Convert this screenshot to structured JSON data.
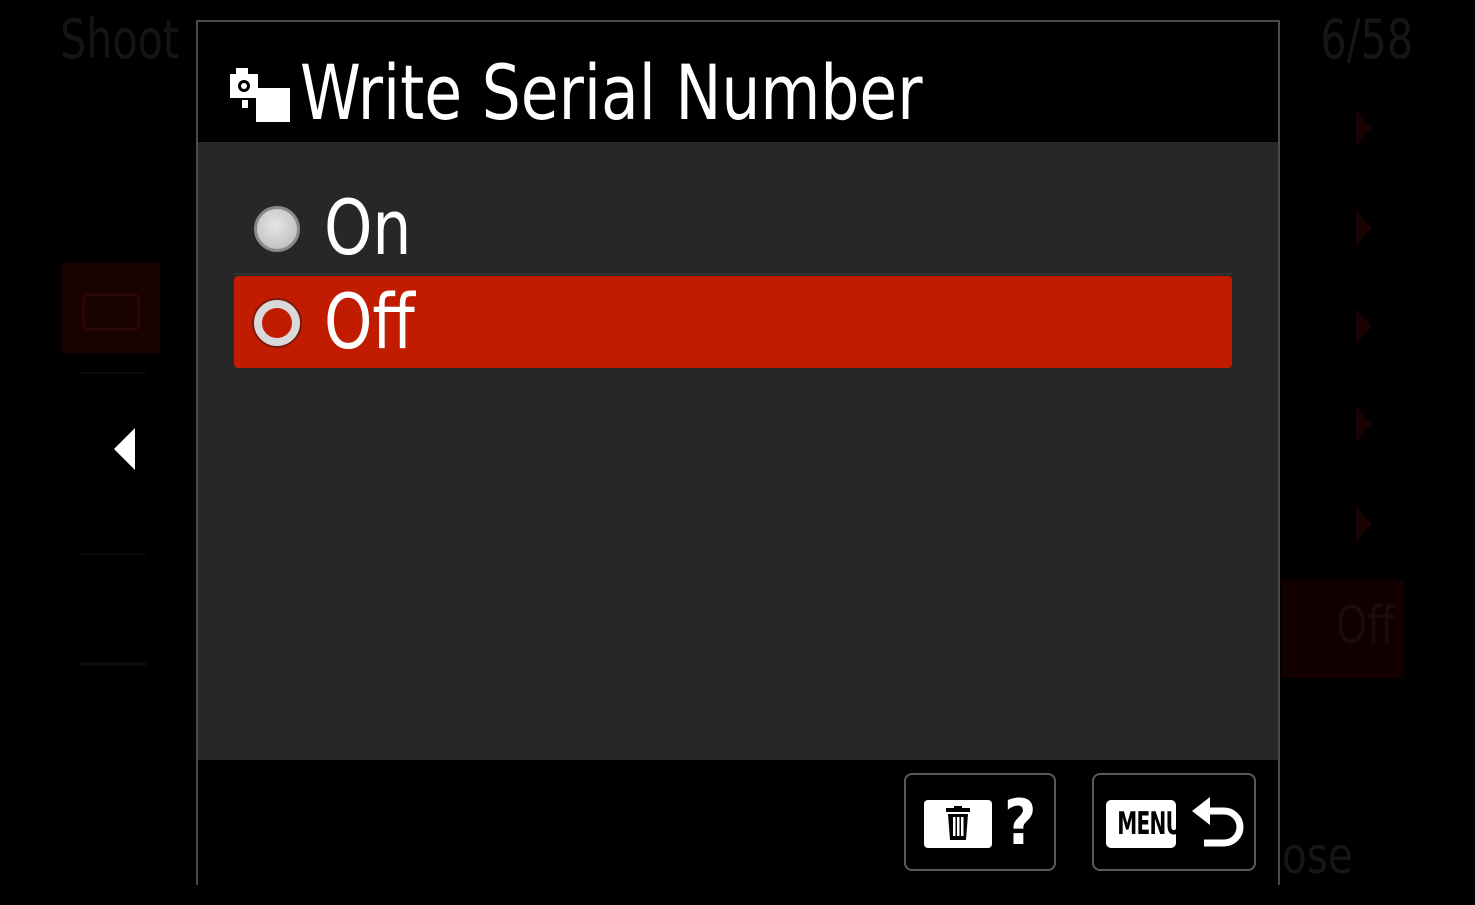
{
  "background_menu": {
    "header_left": "Shoot",
    "page_indicator": "6/58",
    "selected_value": "Off",
    "bottom_text": "ose"
  },
  "dialog": {
    "title": "Write Serial Number",
    "title_icon": "camera-settings-icon",
    "options": [
      {
        "label": "On",
        "selected": false
      },
      {
        "label": "Off",
        "selected": true
      }
    ],
    "footer": {
      "help_button": {
        "icon": "trash-icon",
        "label": "?"
      },
      "menu_button": {
        "badge": "MENU",
        "icon": "return-arrow-icon"
      }
    }
  },
  "colors": {
    "highlight": "#c21c00",
    "panel": "#272727",
    "background": "#000000"
  }
}
